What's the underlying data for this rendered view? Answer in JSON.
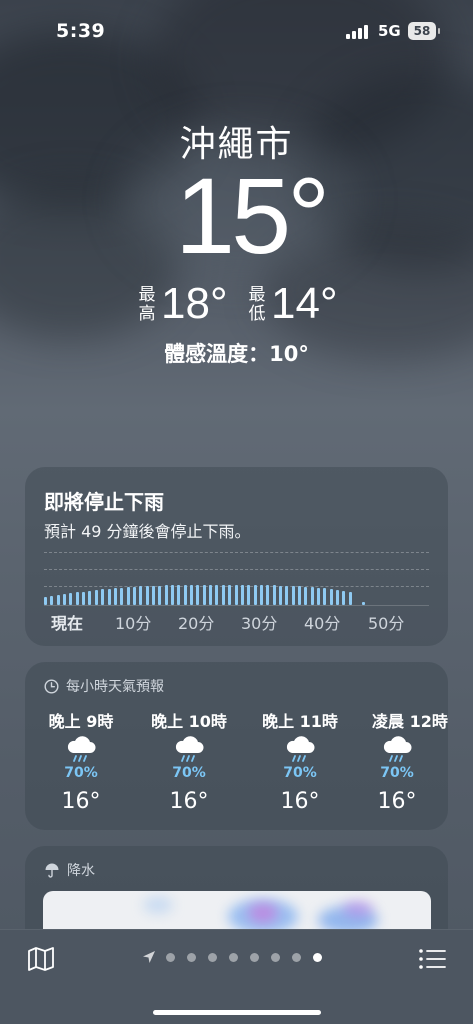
{
  "status": {
    "time": "5:39",
    "network": "5G",
    "battery": "58"
  },
  "location": {
    "city": "沖繩市",
    "temperature": "15°",
    "high_label": "最高",
    "high": "18°",
    "low_label": "最低",
    "low": "14°",
    "feels_like": "體感溫度：10°"
  },
  "precip_card": {
    "title": "即將停止下雨",
    "subtitle": "預計 49 分鐘後會停止下雨。",
    "ticks": [
      "現在",
      "10分",
      "20分",
      "30分",
      "40分",
      "50分"
    ],
    "minute_intensity": [
      0.27,
      0.3,
      0.33,
      0.36,
      0.39,
      0.42,
      0.45,
      0.48,
      0.5,
      0.52,
      0.54,
      0.56,
      0.58,
      0.6,
      0.61,
      0.62,
      0.63,
      0.64,
      0.65,
      0.66,
      0.66,
      0.67,
      0.67,
      0.67,
      0.68,
      0.68,
      0.68,
      0.68,
      0.68,
      0.68,
      0.68,
      0.68,
      0.67,
      0.67,
      0.67,
      0.66,
      0.66,
      0.65,
      0.64,
      0.63,
      0.62,
      0.61,
      0.6,
      0.58,
      0.56,
      0.54,
      0.51,
      0.48,
      0.45,
      0,
      0.1,
      0,
      0,
      0,
      0,
      0,
      0,
      0,
      0,
      0,
      0
    ]
  },
  "hourly_card": {
    "title": "每小時天氣預報",
    "hours": [
      {
        "time": "晚上 9時",
        "precip": "70%",
        "temp": "16°",
        "icon": "cloud-rain-icon"
      },
      {
        "time": "晚上 10時",
        "precip": "70%",
        "temp": "16°",
        "icon": "cloud-rain-icon"
      },
      {
        "time": "晚上 11時",
        "precip": "70%",
        "temp": "16°",
        "icon": "cloud-rain-icon"
      },
      {
        "time": "凌晨 12時",
        "precip": "70%",
        "temp": "16°",
        "icon": "cloud-rain-icon"
      }
    ]
  },
  "precip_map_card": {
    "title": "降水"
  },
  "pager": {
    "count": 8,
    "active_index": 7
  },
  "colors": {
    "rain_bar": "#8fcaf2",
    "precip_pct": "#7cc6f5"
  }
}
